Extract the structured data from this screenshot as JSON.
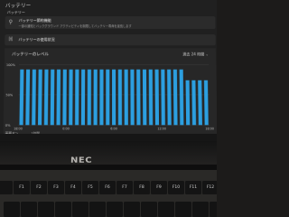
{
  "header": {
    "title": "バッテリー"
  },
  "settings": {
    "section_label": "バッテリー",
    "battery_saver_title": "バッテリー節約機能",
    "battery_saver_description": "一部の通知とバックグラウンド アクティビティを制限してバッテリー寿命を延長します",
    "usage_label": "バッテリーの使用状況"
  },
  "chart": {
    "title": "バッテリーのレベル",
    "range_label": "過去 24 時間",
    "footer_label": "画面オン",
    "footer_suffix": "1時間"
  },
  "taskbar": {},
  "laptop": {
    "brand": "NEC"
  },
  "keyboard": {
    "keys": [
      "",
      "F1",
      "F2",
      "F3",
      "F4",
      "F5",
      "F6",
      "F7",
      "F8",
      "F9",
      "F10",
      "F11",
      "F12"
    ]
  },
  "colors": {
    "bar": "#2c9fe0",
    "panel": "#272727",
    "screen_bg": "#202020"
  },
  "chart_data": {
    "type": "bar",
    "title": "バッテリーのレベル",
    "yticks": [
      "100%",
      "50%",
      "0%"
    ],
    "ylim": [
      0,
      100
    ],
    "xticks": [
      "18:00",
      "",
      "0:00",
      "",
      "6:00",
      "",
      "12:00",
      "",
      "18:00"
    ],
    "values": [
      92,
      92,
      92,
      92,
      92,
      92,
      92,
      92,
      92,
      92,
      92,
      92,
      92,
      92,
      92,
      92,
      92,
      92,
      92,
      92,
      92,
      92,
      92,
      92,
      92,
      92,
      92,
      74,
      74,
      74,
      74
    ],
    "grid": true
  }
}
